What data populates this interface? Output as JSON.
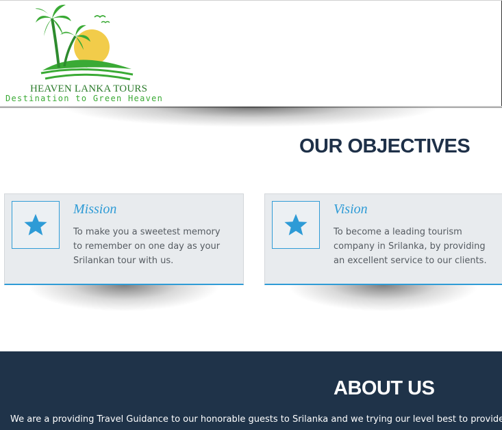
{
  "header": {
    "logo_title": "HEAVEN LANKA TOURS",
    "logo_tagline": "Destination to Green Heaven"
  },
  "objectives": {
    "title": "OUR OBJECTIVES",
    "cards": [
      {
        "title": "Mission",
        "icon": "star-icon",
        "text": "To make you a sweetest memory to remember on one day as your Srilankan tour with us."
      },
      {
        "title": "Vision",
        "icon": "star-icon",
        "text": "To become a leading tourism company in Srilanka, by providing an excellent service to our clients."
      }
    ]
  },
  "about": {
    "title": "ABOUT US",
    "text": "We are a providing Travel Guidance to our honorable guests to Srilanka and we trying our level best to provide excell"
  },
  "colors": {
    "accent": "#2e9bd6",
    "navy": "#1f3349",
    "heading": "#1e3048",
    "card_bg": "#e8ebee",
    "logo_green": "#3aaa35",
    "sun": "#f2cc4a"
  }
}
